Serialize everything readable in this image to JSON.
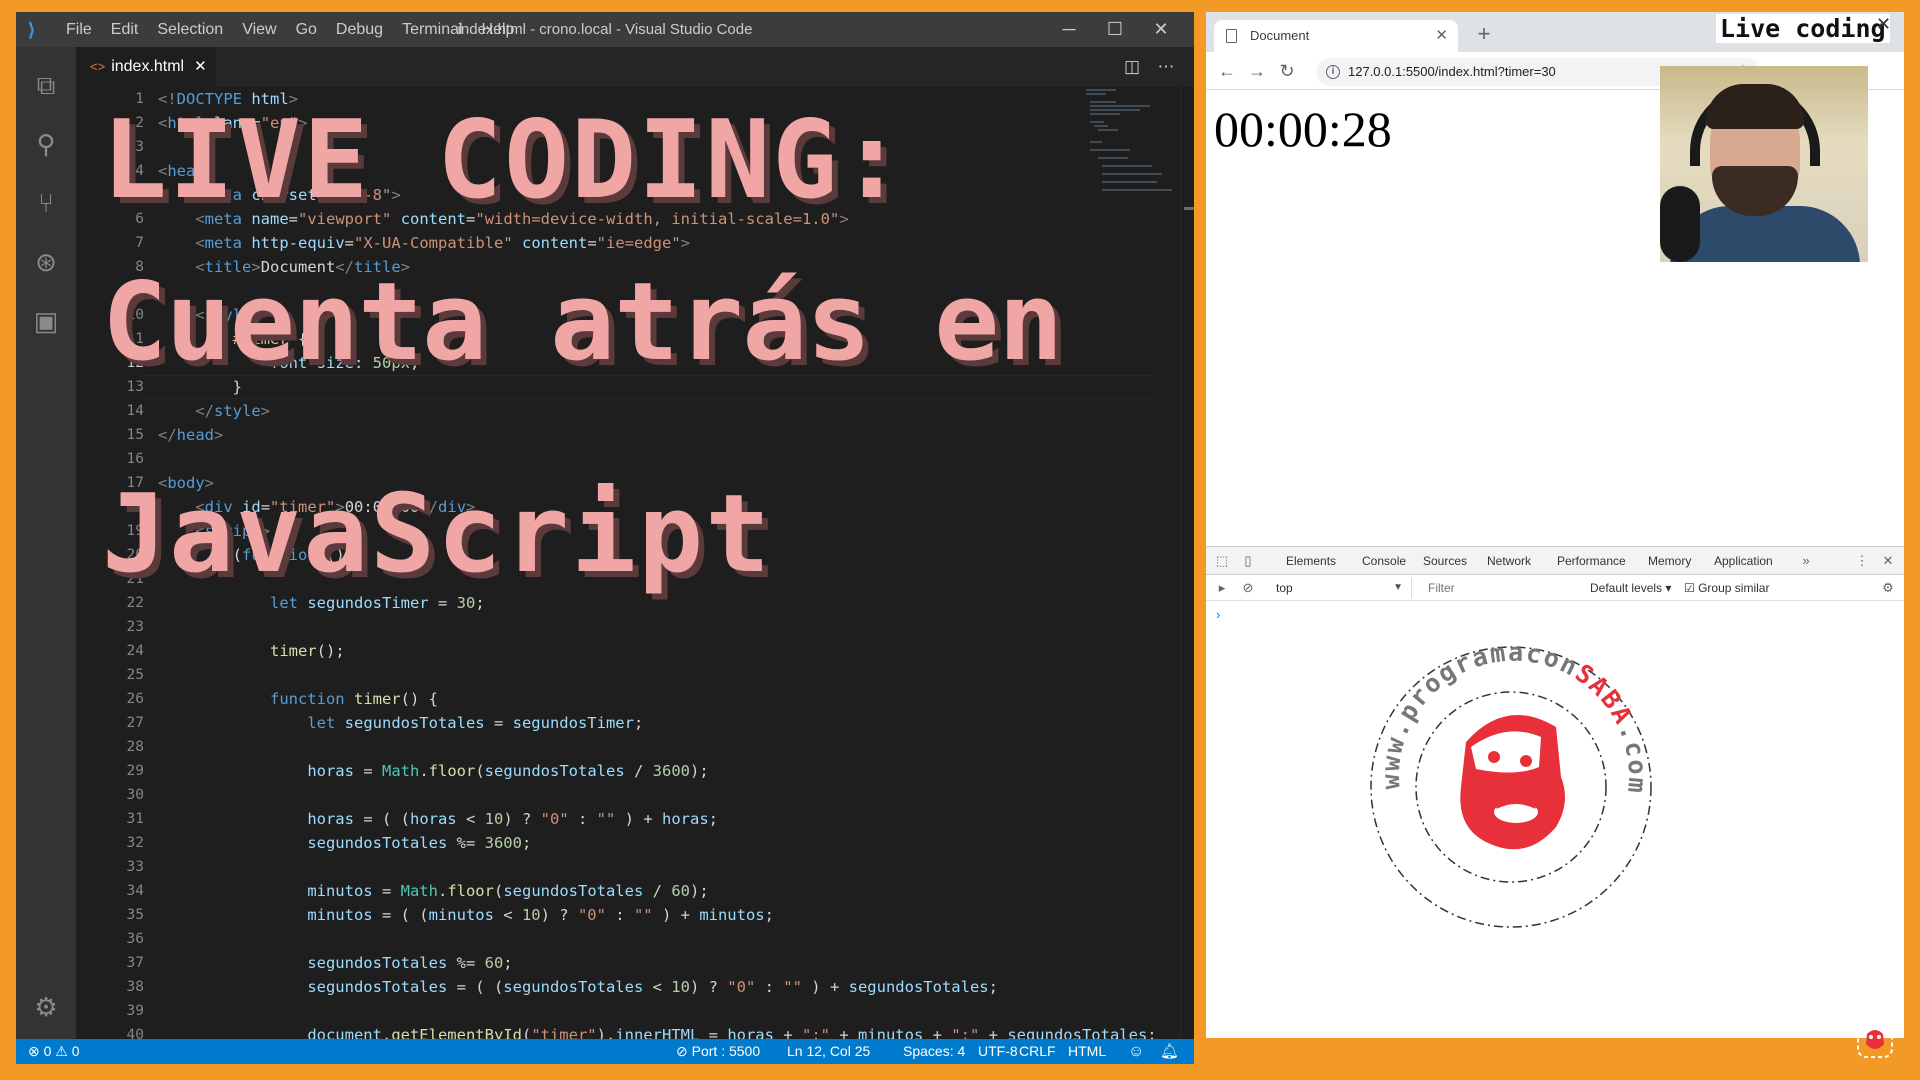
{
  "vscode": {
    "menu": [
      "File",
      "Edit",
      "Selection",
      "View",
      "Go",
      "Debug",
      "Terminal",
      "Help"
    ],
    "window_title": "index.html - crono.local - Visual Studio Code",
    "tab_label": "index.html",
    "line_numbers": [
      "1",
      "2",
      "3",
      "4",
      "5",
      "6",
      "7",
      "8",
      "9",
      "10",
      "11",
      "12",
      "13",
      "14",
      "15",
      "16",
      "17",
      "18",
      "19",
      "20",
      "21",
      "22",
      "23",
      "24",
      "25",
      "26",
      "27",
      "28",
      "29",
      "30",
      "31",
      "32",
      "33",
      "34",
      "35",
      "36",
      "37",
      "38",
      "39",
      "40"
    ],
    "active_line": "12",
    "status": {
      "errors": "0",
      "warnings": "0",
      "port": "Port : 5500",
      "position": "Ln 12, Col 25",
      "spaces": "Spaces: 4",
      "encoding": "UTF-8",
      "eol": "CRLF",
      "language": "HTML"
    }
  },
  "overlay": {
    "line1": "LIVE CODING:",
    "line2": "Cuenta atrás en",
    "line3": "JavaScript"
  },
  "browser": {
    "tab_title": "Document",
    "url": "127.0.0.1:5500/index.html?timer=30",
    "timer_display": "00:00:28",
    "live_label": "Live coding",
    "devtools_tabs": [
      "Elements",
      "Console",
      "Sources",
      "Network",
      "Performance",
      "Memory",
      "Application"
    ],
    "active_devtools_tab": "Console",
    "context": "top",
    "filter_placeholder": "Filter",
    "levels": "Default levels",
    "group_similar": "Group similar",
    "logo_text_top": "www.programacon",
    "logo_text_brand": "SABA",
    "logo_text_end": ".com"
  },
  "colors": {
    "frame": "#f39a26",
    "status_bar": "#007acc",
    "overlay_text": "#f1a6a6",
    "logo_red": "#e8303a"
  }
}
